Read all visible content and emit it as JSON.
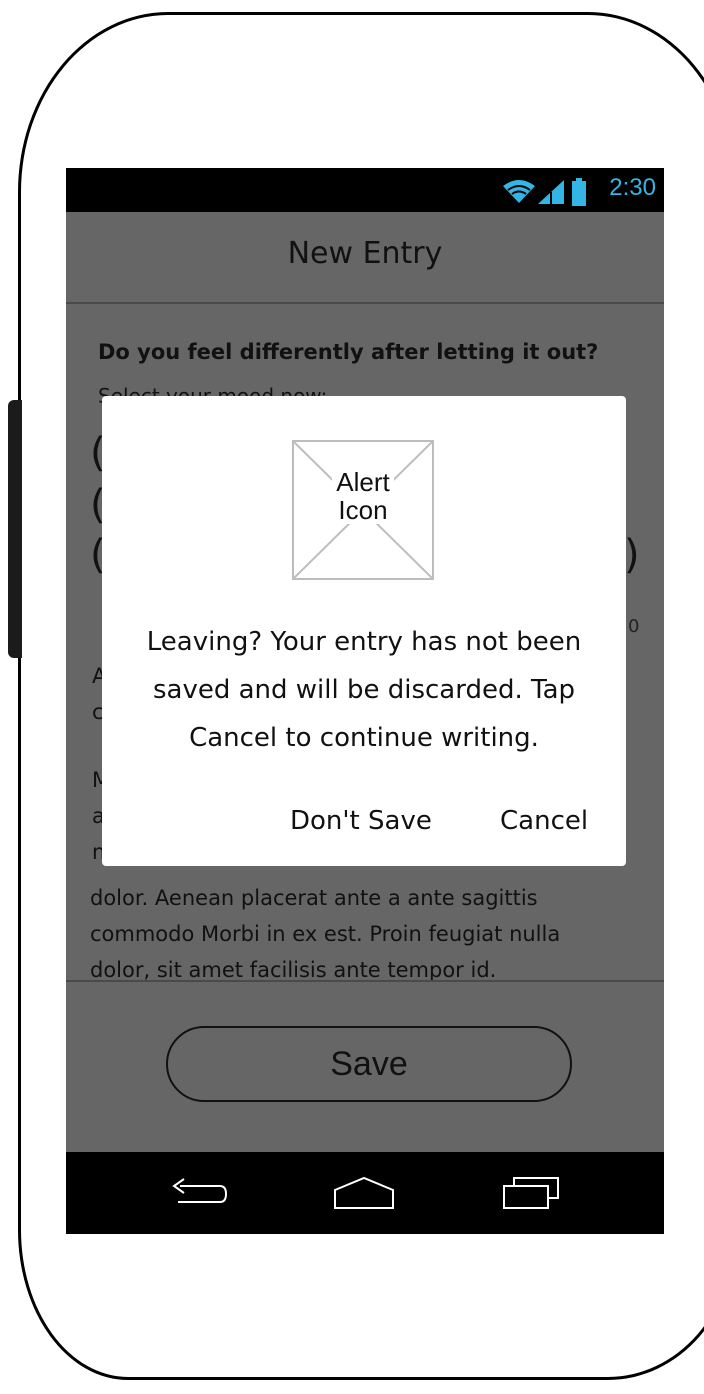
{
  "status_bar": {
    "time": "2:30",
    "time_color": "#33b5e5",
    "icons": [
      "wifi-icon",
      "signal-icon",
      "battery-icon"
    ]
  },
  "app_bar": {
    "title": "New Entry"
  },
  "form": {
    "question": "Do you feel differently after letting it out?",
    "subquestion": "Select your mood now:",
    "scale_fragment": "0",
    "paragraph_fragments": {
      "a1": "A",
      "c1": "c",
      "m1": "M",
      "a2": "a",
      "n1": "n"
    },
    "entry_lines": [
      "dolor. Aenean placerat ante a ante sagittis",
      "commodo Morbi in ex est. Proin feugiat nulla",
      "dolor, sit amet facilisis ante tempor id."
    ]
  },
  "save_label": "Save",
  "dialog": {
    "icon_label_line1": "Alert",
    "icon_label_line2": "Icon",
    "message": "Leaving? Your entry has not been saved and will be discarded. Tap Cancel to continue writing.",
    "dont_save_label": "Don't Save",
    "cancel_label": "Cancel"
  },
  "nav_bar": {
    "icons": [
      "back-icon",
      "home-icon",
      "recents-icon"
    ]
  }
}
